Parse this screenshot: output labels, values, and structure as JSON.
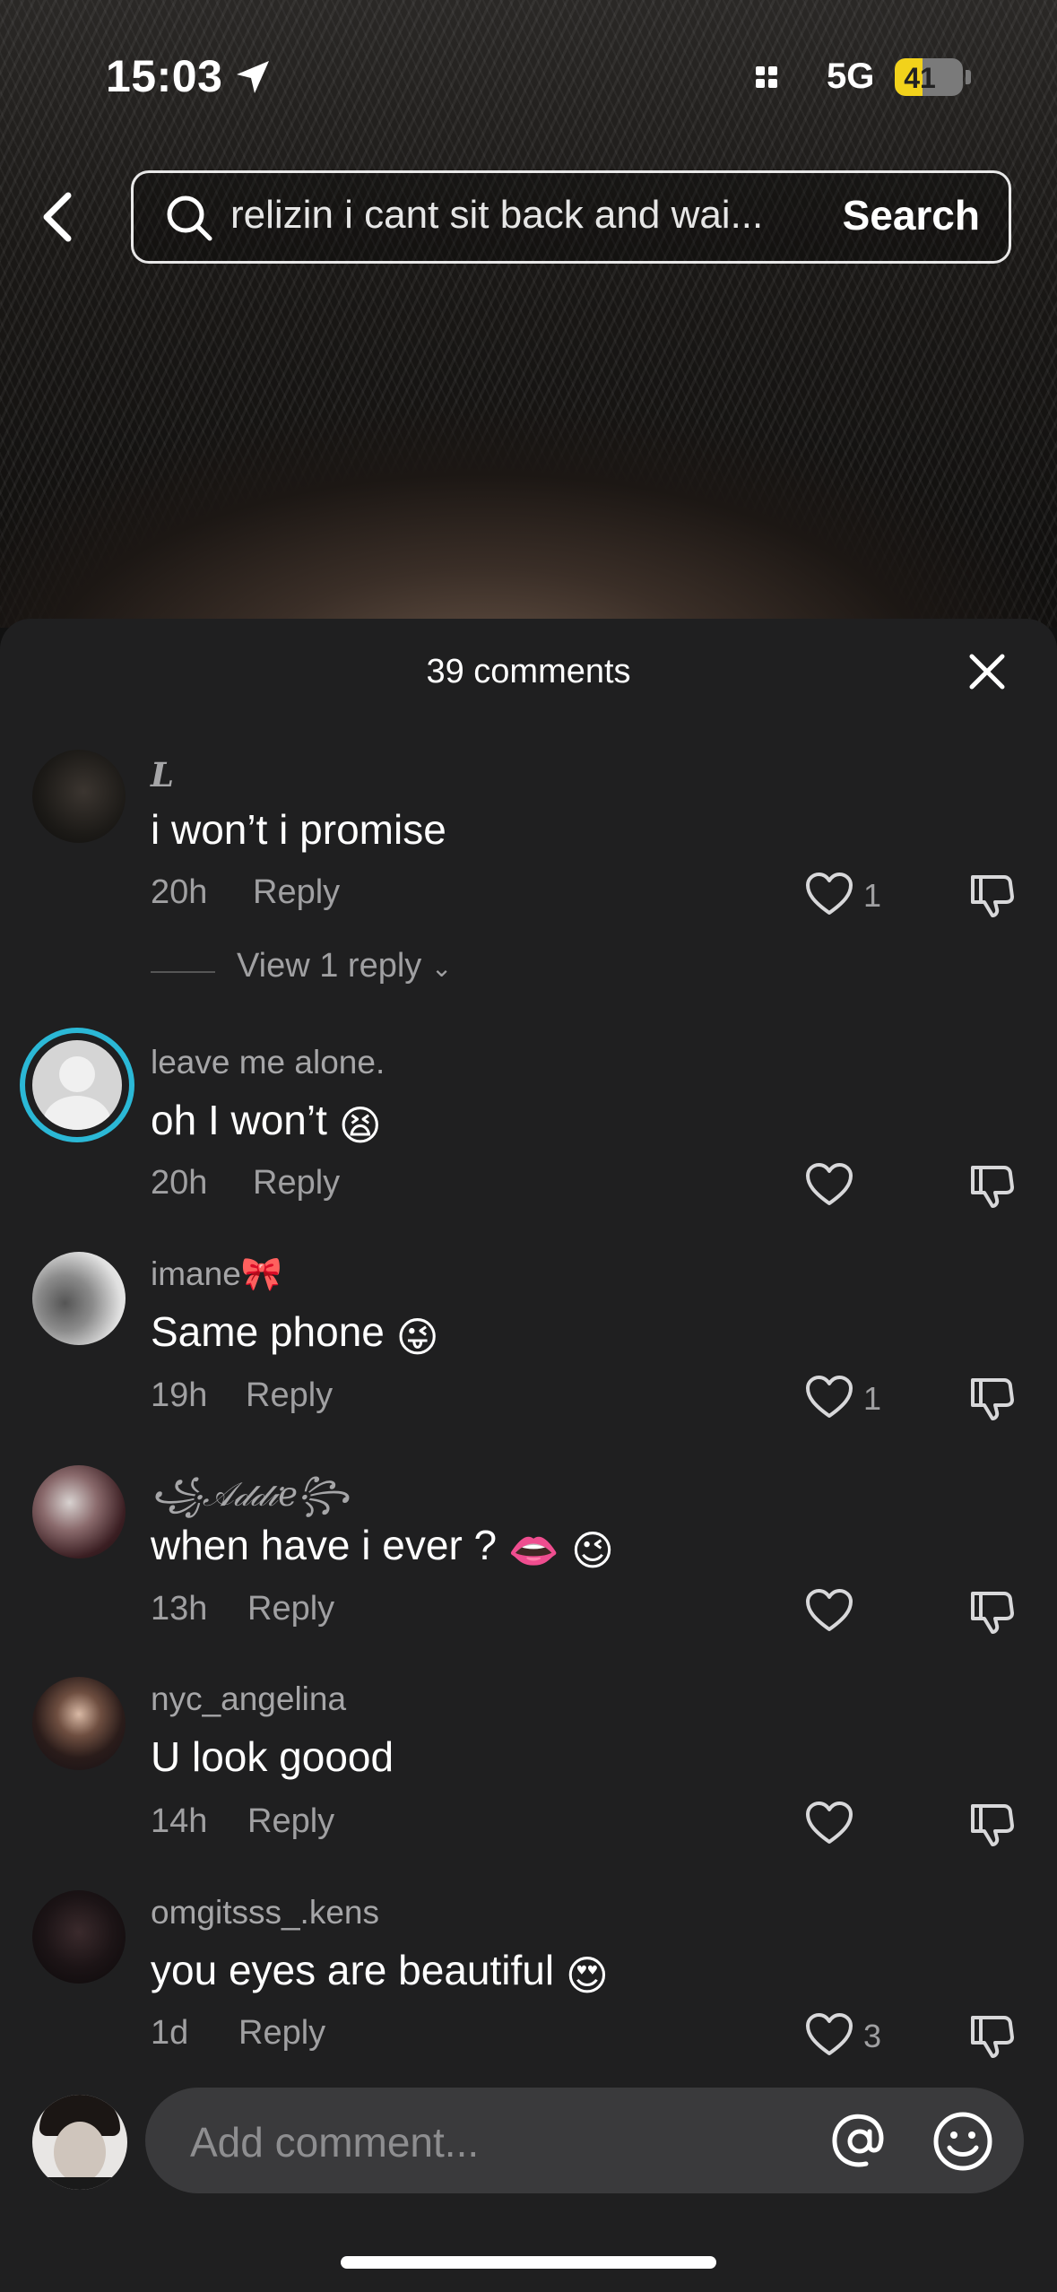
{
  "status_bar": {
    "time": "15:03",
    "network": "5G",
    "battery_percent": 41,
    "battery_label": "41"
  },
  "search": {
    "query": "relizin i cant sit back and wai...",
    "button_label": "Search"
  },
  "comments_header": {
    "title": "39 comments"
  },
  "comments": [
    {
      "username": "L",
      "text": "i won’t i promise",
      "time": "20h",
      "reply_label": "Reply",
      "likes": "1",
      "view_replies": "View 1 reply"
    },
    {
      "username": "leave me alone.",
      "text": "oh I won’t",
      "emoji": "😫",
      "time": "20h",
      "reply_label": "Reply",
      "likes": ""
    },
    {
      "username": "imane🎀",
      "text": "Same phone",
      "emoji": "😜",
      "time": "19h",
      "reply_label": "Reply",
      "likes": "1"
    },
    {
      "username": "꧁𝒜𝒹𝒹𝒾𝑒꧂",
      "text": "when have i ever ?",
      "emoji": "👄 😉",
      "time": "13h",
      "reply_label": "Reply",
      "likes": ""
    },
    {
      "username": "nyc_angelina",
      "text": "U look goood",
      "time": "14h",
      "reply_label": "Reply",
      "likes": ""
    },
    {
      "username": "omgitsss_.kens",
      "text": "you eyes are beautiful",
      "emoji": "😍",
      "time": "1d",
      "reply_label": "Reply",
      "likes": "3"
    }
  ],
  "composer": {
    "placeholder": "Add comment...",
    "icons": [
      "at-icon",
      "emoji-icon"
    ]
  },
  "colors": {
    "sheet_bg": "#1f1f20",
    "muted_text": "#a0a0a2",
    "battery_yellow": "#f2d21b",
    "story_ring": "#2bb8d6"
  }
}
